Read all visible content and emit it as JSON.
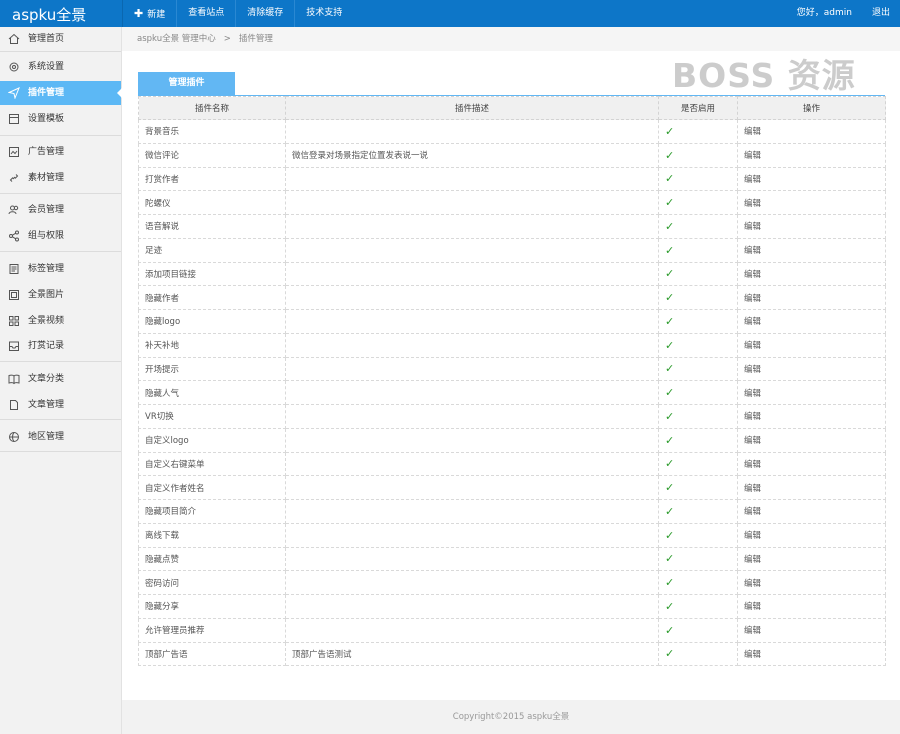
{
  "app": {
    "logo": "aspku全景"
  },
  "topnav": {
    "new_icon": "plus-icon",
    "items": [
      "新建",
      "查看站点",
      "清除缓存",
      "技术支持"
    ],
    "greeting": "您好，admin",
    "logout": "退出"
  },
  "sidebar": {
    "items": [
      {
        "label": "管理首页",
        "icon": "home-icon"
      },
      {
        "label": "系统设置",
        "icon": "gear-icon"
      },
      {
        "label": "插件管理",
        "icon": "send-icon",
        "active": true
      },
      {
        "label": "设置模板",
        "icon": "template-icon"
      },
      {
        "label": "广告管理",
        "icon": "image-icon"
      },
      {
        "label": "素材管理",
        "icon": "link-icon"
      },
      {
        "label": "会员管理",
        "icon": "users-icon"
      },
      {
        "label": "组与权限",
        "icon": "share-icon"
      },
      {
        "label": "标签管理",
        "icon": "document-icon"
      },
      {
        "label": "全景图片",
        "icon": "grid-image-icon"
      },
      {
        "label": "全景视频",
        "icon": "grid-icon"
      },
      {
        "label": "打赏记录",
        "icon": "inbox-icon"
      },
      {
        "label": "文章分类",
        "icon": "book-icon"
      },
      {
        "label": "文章管理",
        "icon": "file-icon"
      },
      {
        "label": "地区管理",
        "icon": "globe-icon"
      }
    ],
    "active_color": "#5cb8f5"
  },
  "breadcrumb": {
    "root": "aspku全景 管理中心",
    "sep": ">",
    "current": "插件管理"
  },
  "watermark": "BOSS 资源",
  "tab": {
    "label": "管理插件"
  },
  "table": {
    "headers": [
      "插件名称",
      "插件描述",
      "是否启用",
      "操作"
    ],
    "check_mark": "✓",
    "rows": [
      {
        "name": "背景音乐",
        "desc": "",
        "edit": "编辑"
      },
      {
        "name": "微信评论",
        "desc": "微信登录对场景指定位置发表说一说",
        "edit": "编辑"
      },
      {
        "name": "打赏作者",
        "desc": "",
        "edit": "编辑"
      },
      {
        "name": "陀螺仪",
        "desc": "",
        "edit": "编辑"
      },
      {
        "name": "语音解说",
        "desc": "",
        "edit": "编辑"
      },
      {
        "name": "足迹",
        "desc": "",
        "edit": "编辑"
      },
      {
        "name": "添加项目链接",
        "desc": "",
        "edit": "编辑"
      },
      {
        "name": "隐藏作者",
        "desc": "",
        "edit": "编辑"
      },
      {
        "name": "隐藏logo",
        "desc": "",
        "edit": "编辑"
      },
      {
        "name": "补天补地",
        "desc": "",
        "edit": "编辑"
      },
      {
        "name": "开场提示",
        "desc": "",
        "edit": "编辑"
      },
      {
        "name": "隐藏人气",
        "desc": "",
        "edit": "编辑"
      },
      {
        "name": "VR切换",
        "desc": "",
        "edit": "编辑"
      },
      {
        "name": "自定义logo",
        "desc": "",
        "edit": "编辑"
      },
      {
        "name": "自定义右键菜单",
        "desc": "",
        "edit": "编辑"
      },
      {
        "name": "自定义作者姓名",
        "desc": "",
        "edit": "编辑"
      },
      {
        "name": "隐藏项目简介",
        "desc": "",
        "edit": "编辑"
      },
      {
        "name": "离线下载",
        "desc": "",
        "edit": "编辑"
      },
      {
        "name": "隐藏点赞",
        "desc": "",
        "edit": "编辑"
      },
      {
        "name": "密码访问",
        "desc": "",
        "edit": "编辑"
      },
      {
        "name": "隐藏分享",
        "desc": "",
        "edit": "编辑"
      },
      {
        "name": "允许管理员推荐",
        "desc": "",
        "edit": "编辑"
      },
      {
        "name": "顶部广告语",
        "desc": "顶部广告语测试",
        "edit": "编辑"
      }
    ]
  },
  "footer": {
    "text": "Copyright©2015   aspku全景"
  },
  "colors": {
    "topbar": "#0d76c8",
    "tab": "#62b7f3",
    "check": "#2a9a2a"
  }
}
